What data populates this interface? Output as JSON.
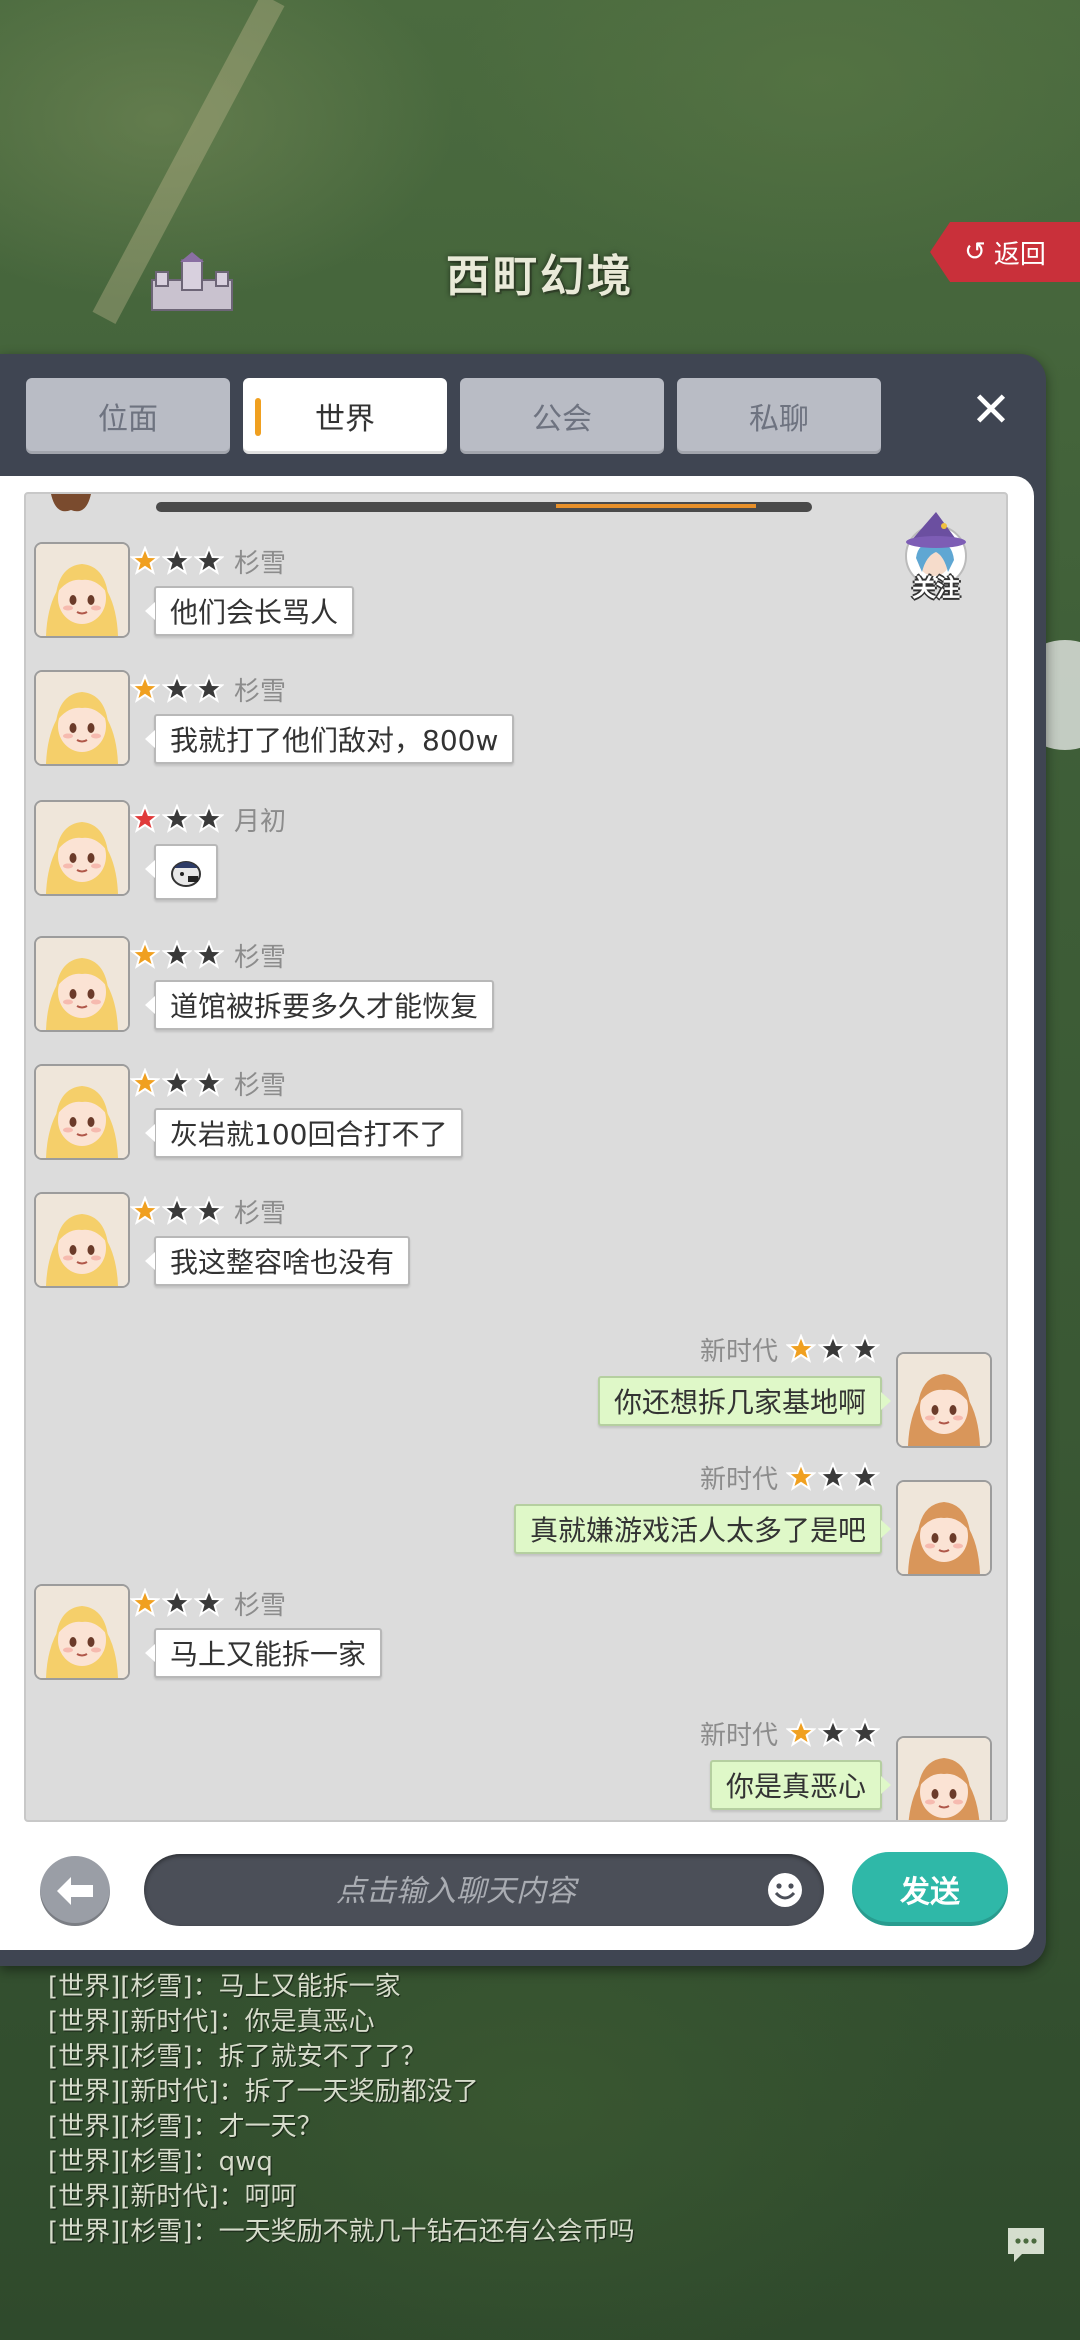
{
  "map": {
    "title": "西町幻境",
    "return_label": "返回"
  },
  "tabs": [
    {
      "label": "位面",
      "active": false
    },
    {
      "label": "世界",
      "active": true
    },
    {
      "label": "公会",
      "active": false
    },
    {
      "label": "私聊",
      "active": false
    }
  ],
  "follow_label": "关注",
  "messages": [
    {
      "side": "left",
      "name": "杉雪",
      "stars": [
        1,
        0,
        0
      ],
      "star_color": "orange",
      "text": "他们会长骂人",
      "avatar": "blonde-girl-avatar"
    },
    {
      "side": "left",
      "name": "杉雪",
      "stars": [
        1,
        0,
        0
      ],
      "star_color": "orange",
      "text": "我就打了他们敌对，800w",
      "avatar": "blonde-girl-avatar"
    },
    {
      "side": "left",
      "name": "月初",
      "stars": [
        1,
        0,
        0
      ],
      "star_color": "red",
      "text": "",
      "sticker": "sticker-icon",
      "avatar": "blonde-girl-avatar"
    },
    {
      "side": "left",
      "name": "杉雪",
      "stars": [
        1,
        0,
        0
      ],
      "star_color": "orange",
      "text": "道馆被拆要多久才能恢复",
      "avatar": "blonde-girl-avatar"
    },
    {
      "side": "left",
      "name": "杉雪",
      "stars": [
        1,
        0,
        0
      ],
      "star_color": "orange",
      "text": "灰岩就100回合打不了",
      "avatar": "blonde-girl-avatar"
    },
    {
      "side": "left",
      "name": "杉雪",
      "stars": [
        1,
        0,
        0
      ],
      "star_color": "orange",
      "text": "我这整容啥也没有",
      "avatar": "blonde-girl-avatar"
    },
    {
      "side": "right",
      "name": "新时代",
      "stars": [
        1,
        0,
        0
      ],
      "star_color": "orange",
      "text": "你还想拆几家基地啊",
      "avatar": "auburn-girl-avatar"
    },
    {
      "side": "right",
      "name": "新时代",
      "stars": [
        1,
        0,
        0
      ],
      "star_color": "orange",
      "text": "真就嫌游戏活人太多了是吧",
      "avatar": "auburn-girl-avatar"
    },
    {
      "side": "left",
      "name": "杉雪",
      "stars": [
        1,
        0,
        0
      ],
      "star_color": "orange",
      "text": "马上又能拆一家",
      "avatar": "blonde-girl-avatar"
    },
    {
      "side": "right",
      "name": "新时代",
      "stars": [
        1,
        0,
        0
      ],
      "star_color": "orange",
      "text": "你是真恶心",
      "avatar": "auburn-girl-avatar"
    }
  ],
  "input": {
    "placeholder": "点击输入聊天内容",
    "value": ""
  },
  "send_label": "发送",
  "world_log": [
    "[世界][杉雪]：马上又能拆一家",
    "[世界][新时代]：你是真恶心",
    "[世界][杉雪]：拆了就安不了了？",
    "[世界][新时代]：拆了一天奖励都没了",
    "[世界][杉雪]：才一天？",
    "[世界][杉雪]：qwq",
    "[世界][新时代]：呵呵",
    "[世界][杉雪]：一天奖励不就几十钻石还有公会币吗"
  ],
  "colors": {
    "send": "#2fb8a8",
    "tab_accent": "#f0a020",
    "star_orange": "#f0a020",
    "star_red": "#e03a3a",
    "bubble_right": "#dff8c8"
  }
}
